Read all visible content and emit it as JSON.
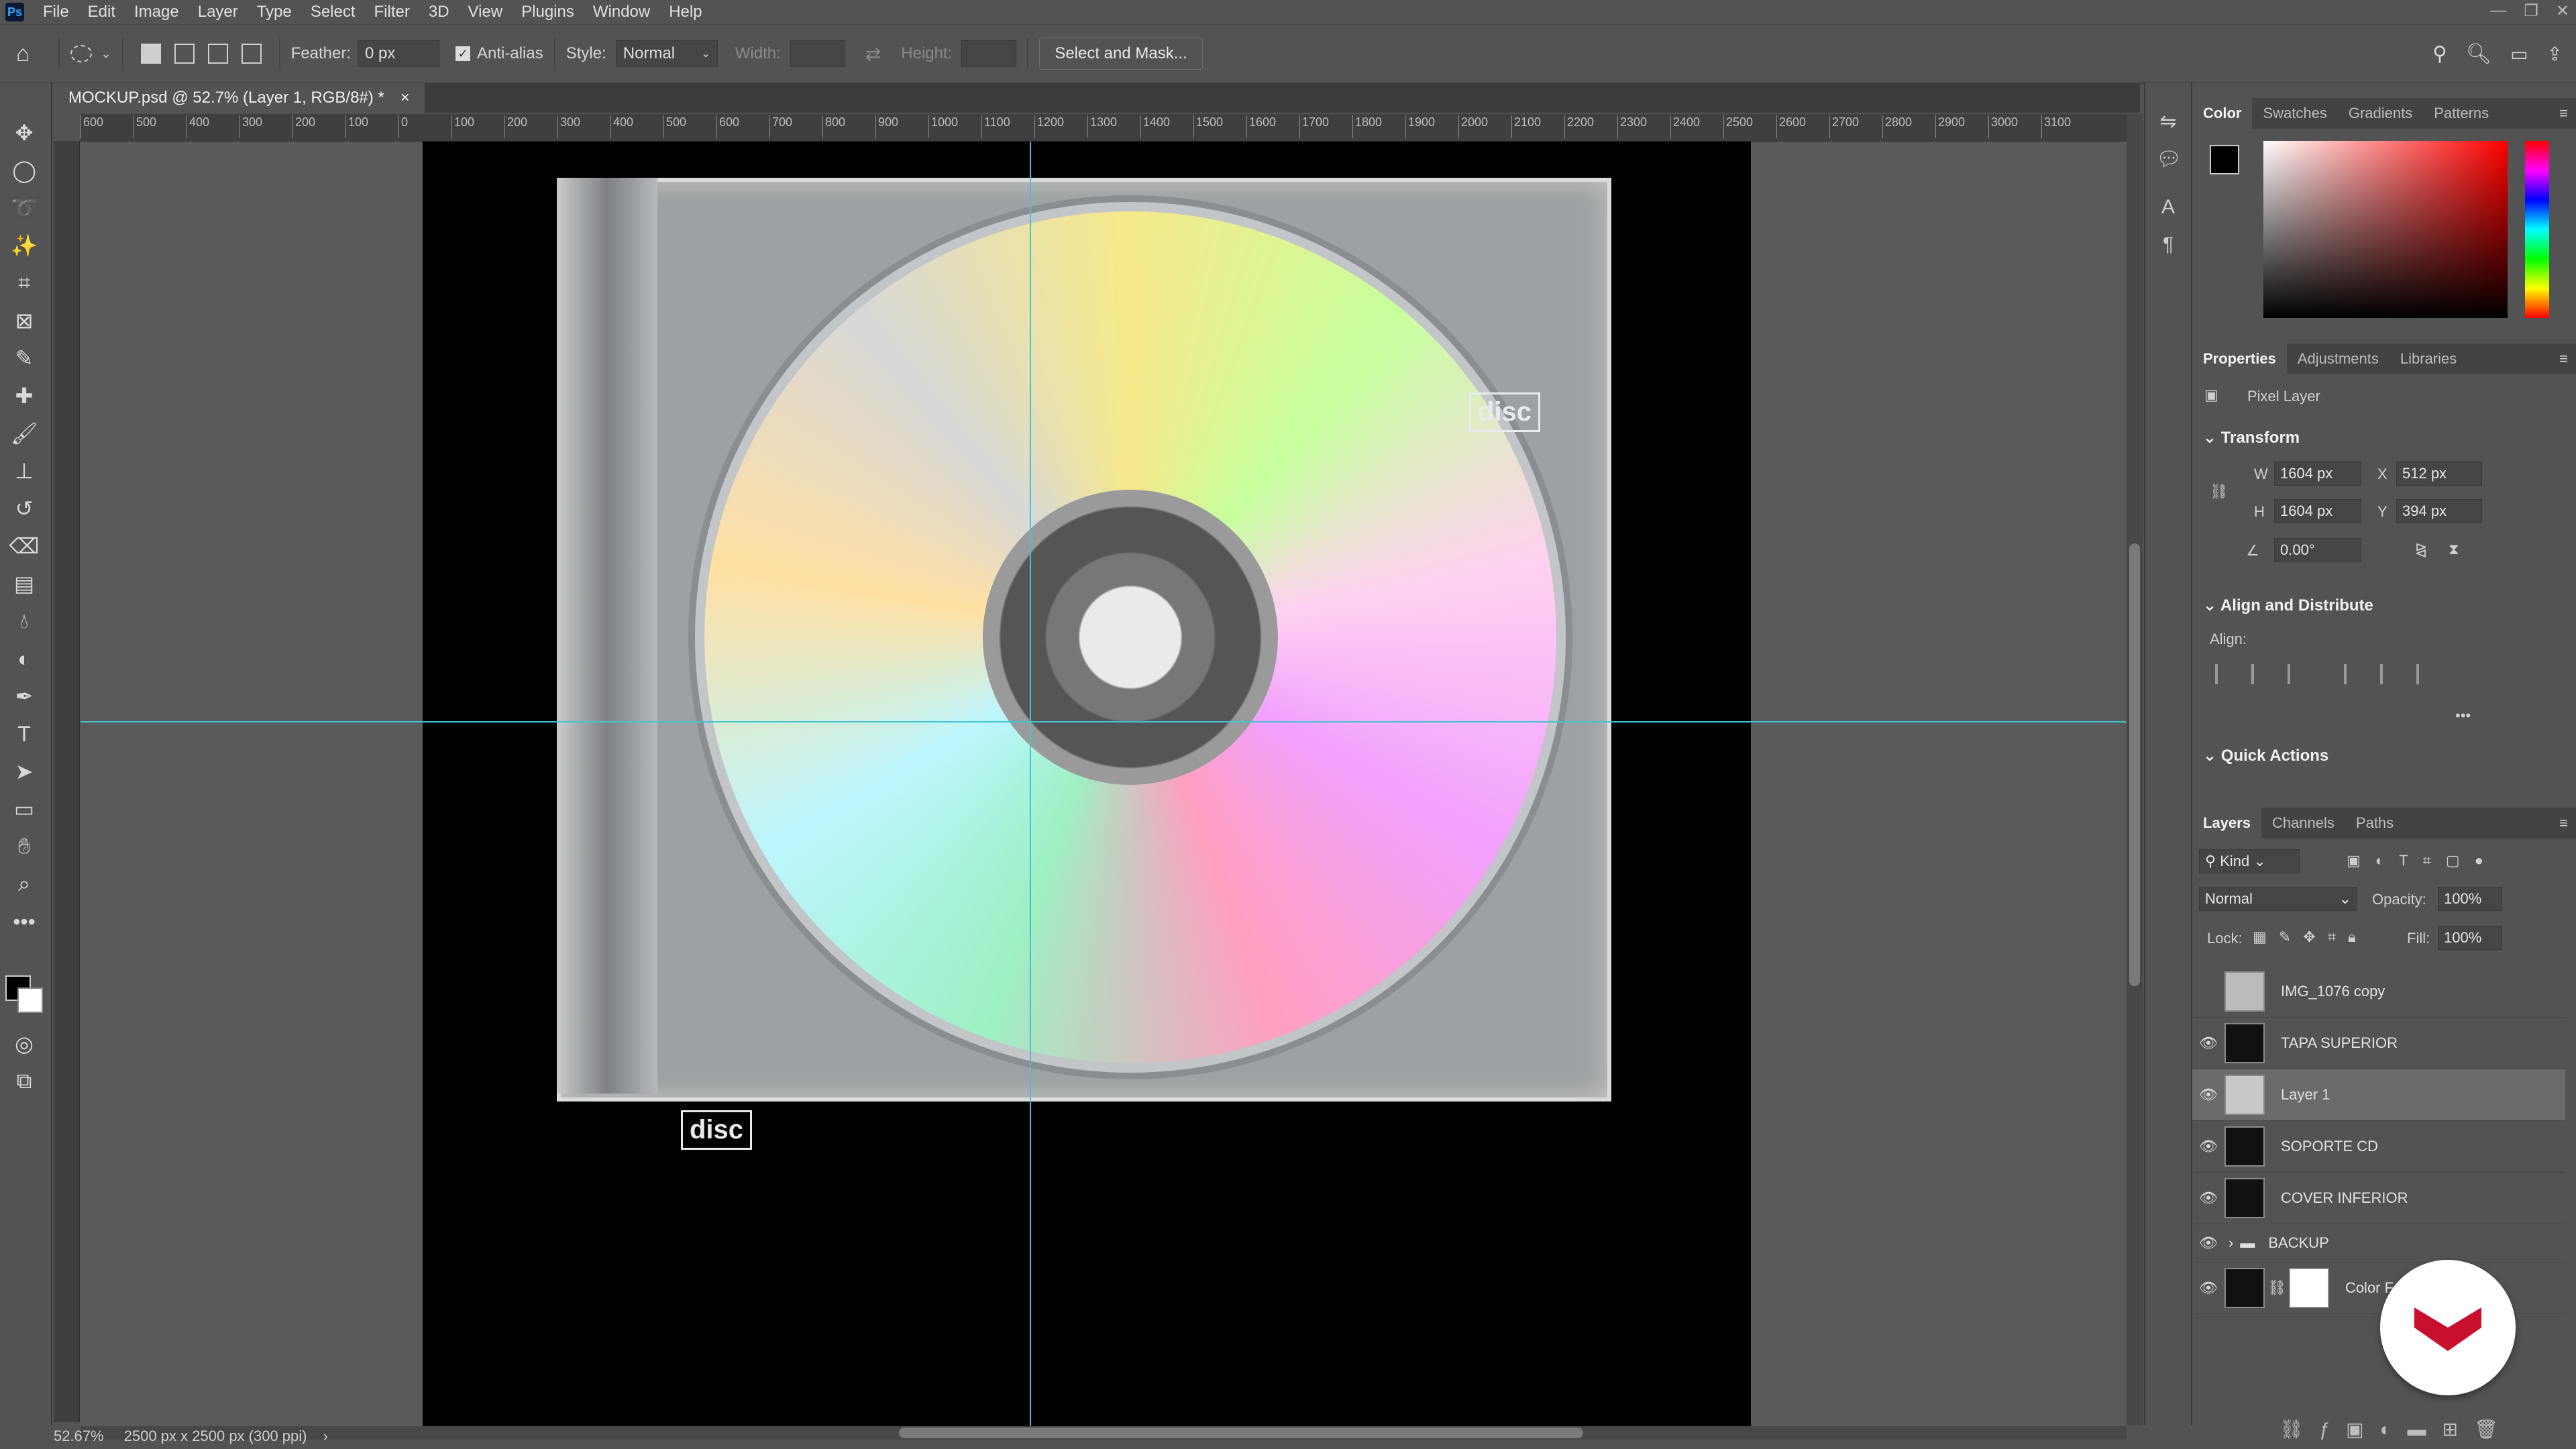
{
  "app": {
    "logo": "Ps"
  },
  "menu": [
    "File",
    "Edit",
    "Image",
    "Layer",
    "Type",
    "Select",
    "Filter",
    "3D",
    "View",
    "Plugins",
    "Window",
    "Help"
  ],
  "options": {
    "feather_label": "Feather:",
    "feather_value": "0 px",
    "antialias_label": "Anti-alias",
    "style_label": "Style:",
    "style_value": "Normal",
    "width_label": "Width:",
    "height_label": "Height:",
    "select_mask": "Select and Mask..."
  },
  "document": {
    "tab_title": "MOCKUP.psd @ 52.7% (Layer 1, RGB/8#) *",
    "close": "×"
  },
  "ruler_top": [
    "600",
    "500",
    "400",
    "300",
    "200",
    "100",
    "0",
    "100",
    "200",
    "300",
    "400",
    "500",
    "600",
    "700",
    "800",
    "900",
    "1000",
    "1100",
    "1200",
    "1300",
    "1400",
    "1500",
    "1600",
    "1700",
    "1800",
    "1900",
    "2000",
    "2100",
    "2200",
    "2300",
    "2400",
    "2500",
    "2600",
    "2700",
    "2800",
    "2900",
    "3000",
    "3100"
  ],
  "status": {
    "zoom": "52.67%",
    "doc_info": "2500 px x 2500 px (300 ppi)",
    "arrow": "›"
  },
  "color_panel": {
    "tabs": [
      "Color",
      "Swatches",
      "Gradients",
      "Patterns"
    ]
  },
  "properties": {
    "tabs": [
      "Properties",
      "Adjustments",
      "Libraries"
    ],
    "layer_type": "Pixel Layer",
    "transform_title": "Transform",
    "w_label": "W",
    "w_value": "1604 px",
    "h_label": "H",
    "h_value": "1604 px",
    "x_label": "X",
    "x_value": "512 px",
    "y_label": "Y",
    "y_value": "394 px",
    "angle_value": "0.00°",
    "align_title": "Align and Distribute",
    "align_label": "Align:",
    "more": "•••",
    "quick_title": "Quick Actions"
  },
  "layers_panel": {
    "tabs": [
      "Layers",
      "Channels",
      "Paths"
    ],
    "kind": "Kind",
    "blend": "Normal",
    "opacity_label": "Opacity:",
    "opacity_value": "100%",
    "lock_label": "Lock:",
    "fill_label": "Fill:",
    "fill_value": "100%",
    "layers": [
      {
        "name": "IMG_1076 copy",
        "visible": false
      },
      {
        "name": "TAPA SUPERIOR",
        "visible": true
      },
      {
        "name": "Layer 1",
        "visible": true
      },
      {
        "name": "SOPORTE CD",
        "visible": true
      },
      {
        "name": "COVER INFERIOR",
        "visible": true
      },
      {
        "name": "BACKUP",
        "visible": true
      },
      {
        "name": "Color F",
        "visible": true
      }
    ]
  },
  "canvas": {
    "case_logo": "disc",
    "guide_color": "#41c4d3",
    "brand_color": "#c8102e"
  }
}
